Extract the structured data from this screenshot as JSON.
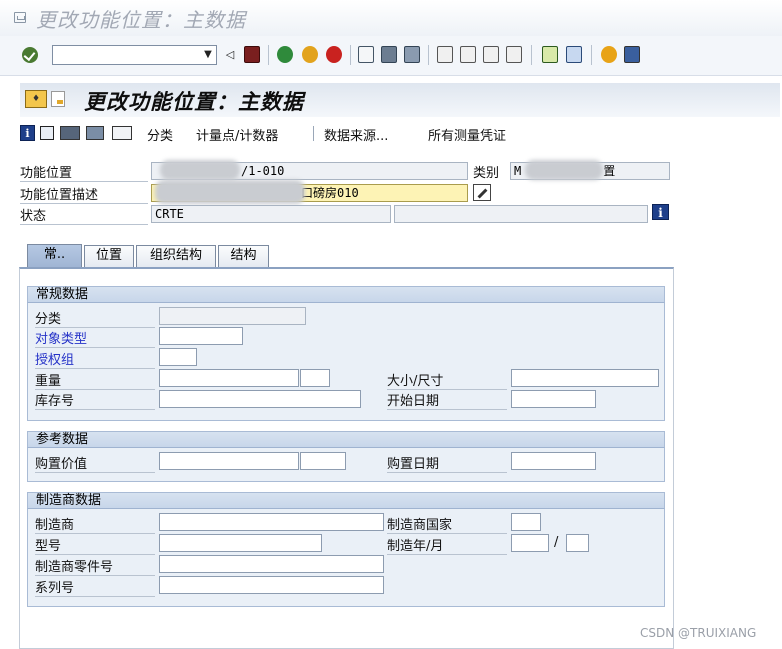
{
  "window": {
    "title": "更改功能位置：主数据"
  },
  "toolbar": {
    "command_field": {
      "value": "",
      "placeholder": ""
    },
    "icons": [
      "back-triangle-icon",
      "save-icon",
      "back-icon",
      "exit-icon",
      "cancel-icon",
      "print-icon",
      "find-icon",
      "find-next-icon",
      "first-page-icon",
      "previous-page-icon",
      "next-page-icon",
      "last-page-icon",
      "new-session-icon",
      "shortcut-icon",
      "help-icon",
      "layout-icon"
    ]
  },
  "header": {
    "title": "更改功能位置：主数据"
  },
  "app_toolbar": {
    "buttons": [
      "分类",
      "计量点/计数器",
      "数据来源...",
      "所有测量凭证"
    ]
  },
  "fields": {
    "func_loc": {
      "label": "功能位置",
      "value_suffix": "/1-010"
    },
    "category": {
      "label": "类别",
      "value_prefix": "M",
      "value_suffix": "置"
    },
    "func_loc_desc": {
      "label": "功能位置描述",
      "value_suffix": "口磅房010"
    },
    "status": {
      "label": "状态",
      "value": "CRTE",
      "value2": ""
    }
  },
  "tabs": [
    "常..",
    "位置",
    "组织结构",
    "结构"
  ],
  "groups": {
    "general": {
      "title": "常规数据",
      "class": {
        "label": "分类",
        "value": ""
      },
      "object_type": {
        "label": "对象类型",
        "value": ""
      },
      "auth_group": {
        "label": "授权组",
        "value": ""
      },
      "weight": {
        "label": "重量",
        "value": "",
        "unit": ""
      },
      "size": {
        "label": "大小/尺寸",
        "value": ""
      },
      "inventory_no": {
        "label": "库存号",
        "value": ""
      },
      "start_date": {
        "label": "开始日期",
        "value": ""
      }
    },
    "reference": {
      "title": "参考数据",
      "acq_value": {
        "label": "购置价值",
        "value": "",
        "currency": ""
      },
      "acq_date": {
        "label": "购置日期",
        "value": ""
      }
    },
    "manufacturer": {
      "title": "制造商数据",
      "manufacturer": {
        "label": "制造商",
        "value": ""
      },
      "country": {
        "label": "制造商国家",
        "value": ""
      },
      "model": {
        "label": "型号",
        "value": ""
      },
      "year_month": {
        "label": "制造年/月",
        "year": "",
        "sep": "/",
        "month": ""
      },
      "part_no": {
        "label": "制造商零件号",
        "value": ""
      },
      "serial_no": {
        "label": "系列号",
        "value": ""
      }
    }
  },
  "watermark": "CSDN @TRUIXIANG",
  "colors": {
    "link": "#2633c8",
    "required_field": "#fdf3b5",
    "group_bg": "#eaf0f7",
    "tab_active": "#b5c8e3",
    "info_icon": "#1e3f8a"
  }
}
